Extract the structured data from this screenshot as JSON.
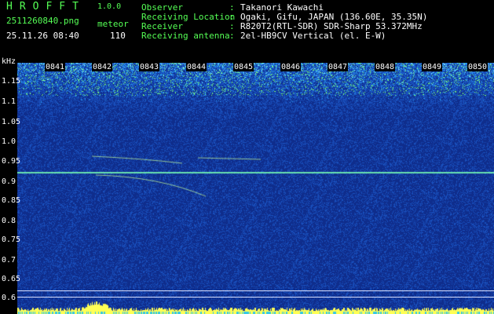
{
  "header": {
    "app_title": "HROFFT",
    "app_version": "1.0.0",
    "filename": "2511260840.png",
    "meteor_label": "meteor",
    "timestamp": "25.11.26 08:40",
    "meteor_count": "110"
  },
  "metadata": [
    {
      "label": "Observer",
      "value": "Takanori Kawachi"
    },
    {
      "label": "Receiving Location",
      "value": "Ogaki, Gifu, JAPAN (136.60E, 35.35N)"
    },
    {
      "label": "Receiver",
      "value": "R820T2(RTL-SDR) SDR-Sharp 53.372MHz"
    },
    {
      "label": "Receiving antenna",
      "value": "2el-HB9CV Vertical (el. E-W)"
    }
  ],
  "separator": ":",
  "y_axis": {
    "unit": "kHz",
    "ticks": [
      "1.1",
      "1.0",
      "0.9",
      "0.8",
      "0.7",
      "0.6"
    ],
    "minor_ticks": [
      "1.15",
      "1.05",
      "0.95",
      "0.85",
      "0.75",
      "0.65"
    ]
  },
  "time_axis": [
    "0841",
    "0842",
    "0843",
    "0844",
    "0845",
    "0846",
    "0847",
    "0848",
    "0849",
    "0850"
  ],
  "colors": {
    "label_green": "#55ff55",
    "label_white": "#ffffff",
    "signal_yellow": "#ffff55",
    "background_blue": "#143a94"
  }
}
